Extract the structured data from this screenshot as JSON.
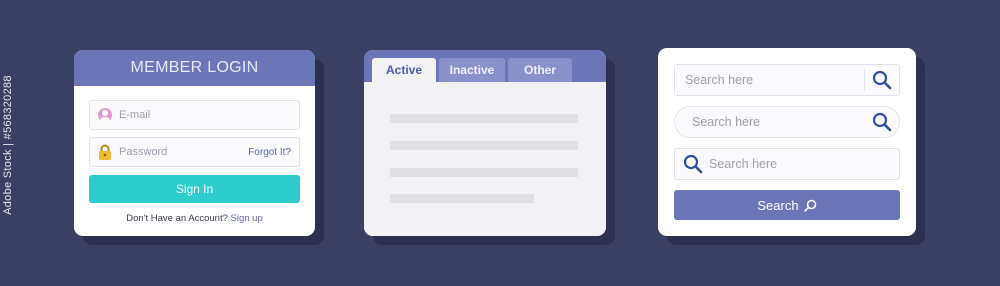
{
  "stock_id": "Adobe Stock | #568320288",
  "login": {
    "title": "MEMBER LOGIN",
    "email_placeholder": "E-mail",
    "password_placeholder": "Password",
    "forgot_label": "Forgot It?",
    "signin_label": "Sign In",
    "no_account_text": "Don't Have an Account?",
    "signup_label": "Sign up",
    "icons": [
      "user-avatar-icon",
      "padlock-icon"
    ]
  },
  "tabs": {
    "items": [
      {
        "label": "Active",
        "state": "active"
      },
      {
        "label": "Inactive",
        "state": "inactive"
      },
      {
        "label": "Other",
        "state": "inactive"
      }
    ]
  },
  "search": {
    "field_1_placeholder": "Search here",
    "field_2_placeholder": "Search here",
    "field_3_placeholder": "Search here",
    "button_label": "Search",
    "icons": [
      "magnifier-icon"
    ]
  },
  "colors": {
    "background": "#3b3f63",
    "accent": "#6b76b8",
    "signin": "#2ecccc",
    "link": "#5b67b0",
    "search_icon": "#2f4fa5"
  }
}
